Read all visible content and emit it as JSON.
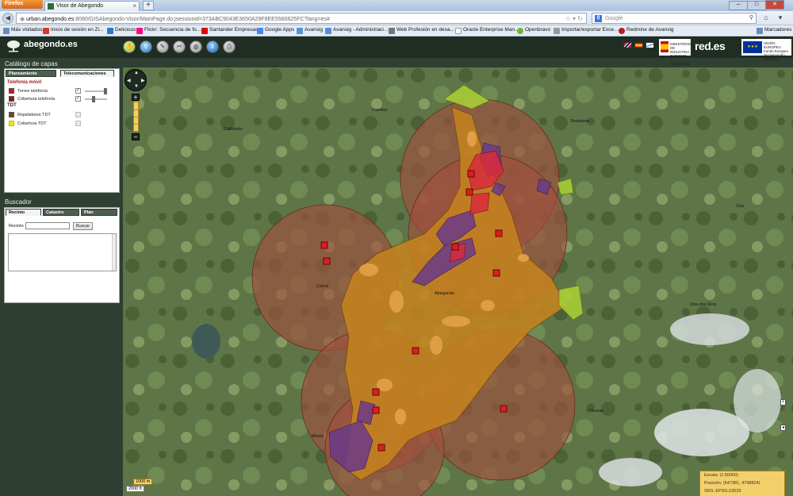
{
  "browser": {
    "app_button": "Firefox",
    "tab_title": "Visor de Abegondo",
    "new_tab": "+",
    "url_host": "urban.abegondo.es",
    "url_rest": ":8080/GISAbegondo-Visor/MainPage.do;jsessionid=373ABC9043E3650A29F8EE5560825FC?lang=es#",
    "search_placeholder": "Google",
    "bookmarks_menu": "Marcadores"
  },
  "bookmarks": [
    {
      "label": "Más visitados",
      "color": "#6a8bbf"
    },
    {
      "label": "Inicio de sesión en Zi...",
      "color": "#d43a2f"
    },
    {
      "label": "Delicious",
      "color": "#3274d6"
    },
    {
      "label": "Flickr: Secuencia de fo...",
      "color": "#ff0084"
    },
    {
      "label": "Santander Empresas",
      "color": "#e60000"
    },
    {
      "label": "Google Apps",
      "color": "#4285f4"
    },
    {
      "label": "Avansig",
      "color": "#5a8fd6"
    },
    {
      "label": "Avansig - Administraci...",
      "color": "#5a8fd6"
    },
    {
      "label": "Web Profesión en desa...",
      "color": "#777777"
    },
    {
      "label": "Oracle Enterprise Man...",
      "color": "#ffffff"
    },
    {
      "label": "Openbravo",
      "color": "#6bb832"
    },
    {
      "label": "Importar/exportar Exce...",
      "color": "#999999"
    },
    {
      "label": "Redmine de Avansig",
      "color": "#b32020"
    }
  ],
  "app": {
    "logo_text": "abegondo.es",
    "brand_right": "red.es",
    "gov_text": "MINISTERIO DE INDUSTRIA, TURISMO Y COMERCIO",
    "eu_text": "UNIÓN EUROPEA Fondo Europeo de Desarrollo Regional"
  },
  "catalog": {
    "title": "Catálogo de capas",
    "tabs": [
      "Planeamiento",
      "Telecomunicaciones"
    ],
    "section1": "Telefonía móvil",
    "section2": "TDT",
    "layers": [
      {
        "label": "Torres telefonía",
        "color": "#c21a1a",
        "checked": "✓"
      },
      {
        "label": "Cobertura telefonía",
        "color": "#8a1a1a",
        "checked": "✓"
      },
      {
        "label": "Repetidores TDT",
        "color": "#6b4a2a",
        "checked": ""
      },
      {
        "label": "Cobertura TDT",
        "color": "#f2e21b",
        "checked": ""
      }
    ]
  },
  "search": {
    "title": "Buscador",
    "tabs": [
      "Recinto",
      "Catastro",
      "Plan"
    ],
    "field_label": "Recinto",
    "field_value": "",
    "button": "Buscar"
  },
  "map": {
    "labels": [
      "Cambre",
      "Culleredo",
      "Betanzos",
      "Oza",
      "Carral",
      "Abegondo",
      "Oza dos Ríos",
      "Mesía",
      "Coiruras"
    ],
    "scale_top": "1000 m",
    "scale_bottom": "2000 ft",
    "info": {
      "scale": "Escala: (1:50000)",
      "position": "Posición: (547381, 4798824)",
      "srs": "SRS: EPSG:23029"
    }
  },
  "colors": {
    "coverage_brown": "#a0503e",
    "tdt_orange": "#c7841e",
    "purple": "#6a3a88",
    "red": "#d82c3a",
    "green": "#a9cc35"
  }
}
